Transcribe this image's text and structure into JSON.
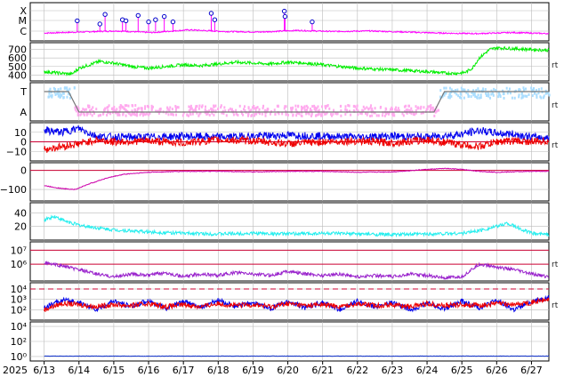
{
  "chart_data": {
    "type": "line",
    "x_axis": {
      "year_label": "2025",
      "start": "2025-06-13",
      "end": "2025-06-27",
      "tick_labels": [
        "6/13",
        "6/14",
        "6/15",
        "6/16",
        "6/17",
        "6/18",
        "6/19",
        "6/20",
        "6/21",
        "6/22",
        "6/23",
        "6/24",
        "6/25",
        "6/26",
        "6/27"
      ],
      "grid": true
    },
    "colors": {
      "magenta": "#ff00ff",
      "green": "#00ee00",
      "light_blue": "#aaddff",
      "pink": "#ffaaee",
      "gray": "#777777",
      "blue": "#0000ee",
      "red": "#ee0000",
      "crimson": "#cc0033",
      "purple_line": "#cc00aa",
      "cyan": "#22eeee",
      "violet": "#9922cc",
      "dark_blue": "#1133cc",
      "grid": "#bbbbbb"
    },
    "panels": [
      {
        "id": "xray",
        "type": "line",
        "y_tick_labels": [
          "X",
          "M",
          "C"
        ],
        "right_label": "",
        "series": [
          {
            "color": "magenta",
            "values": [
              0.15,
              0.25,
              0.35,
              0.2,
              0.45,
              0.3,
              0.25,
              0.4,
              0.3,
              0.35,
              0.25,
              0.15,
              0.1,
              0.2,
              0.1
            ]
          }
        ],
        "flare_markers": [
          {
            "x": 0.95,
            "level": 1.3
          },
          {
            "x": 1.6,
            "level": 1.0
          },
          {
            "x": 1.75,
            "level": 1.9
          },
          {
            "x": 2.25,
            "level": 1.4
          },
          {
            "x": 2.35,
            "level": 1.3
          },
          {
            "x": 2.7,
            "level": 1.8
          },
          {
            "x": 3.0,
            "level": 1.2
          },
          {
            "x": 3.2,
            "level": 1.4
          },
          {
            "x": 3.45,
            "level": 1.7
          },
          {
            "x": 3.7,
            "level": 1.2
          },
          {
            "x": 4.8,
            "level": 2.0
          },
          {
            "x": 4.9,
            "level": 1.4
          },
          {
            "x": 6.9,
            "level": 2.2
          },
          {
            "x": 6.92,
            "level": 1.7
          },
          {
            "x": 7.7,
            "level": 1.2
          }
        ]
      },
      {
        "id": "solar_wind_speed",
        "type": "line",
        "y_tick_labels": [
          "700",
          "600",
          "500",
          "400"
        ],
        "y_ticks": [
          700,
          600,
          500,
          400
        ],
        "ylim": [
          330,
          780
        ],
        "right_label": "rt",
        "series": [
          {
            "color": "green",
            "x": [
              0,
              0.5,
              0.8,
              1.0,
              1.3,
              1.6,
              2.0,
              2.5,
              3.0,
              3.5,
              4.0,
              4.5,
              5.0,
              5.5,
              6.0,
              6.5,
              7.0,
              7.5,
              8.0,
              8.5,
              9.0,
              9.5,
              10.0,
              10.5,
              11.0,
              11.3,
              11.6,
              11.9,
              12.1,
              12.3,
              12.5,
              12.8,
              13.0,
              13.5,
              14.0,
              14.5
            ],
            "values": [
              440,
              420,
              410,
              480,
              520,
              560,
              540,
              500,
              480,
              500,
              520,
              510,
              530,
              550,
              540,
              530,
              550,
              540,
              520,
              500,
              480,
              470,
              460,
              450,
              440,
              430,
              420,
              420,
              430,
              480,
              600,
              700,
              720,
              710,
              700,
              690
            ]
          }
        ]
      },
      {
        "id": "imf_sector",
        "type": "line",
        "y_tick_labels": [
          "T",
          "A"
        ],
        "right_label": "rt",
        "series": [
          {
            "color": "gray",
            "x": [
              0,
              0.7,
              1.0,
              1.1,
              11.2,
              11.5,
              14.5
            ],
            "values": [
              1,
              1,
              0,
              0,
              0,
              1,
              1
            ]
          }
        ]
      },
      {
        "id": "imf_components",
        "type": "line",
        "y_tick_labels": [
          "10",
          "0",
          "−10"
        ],
        "y_ticks": [
          10,
          0,
          -10
        ],
        "ylim": [
          -20,
          20
        ],
        "right_label": "rt",
        "series": [
          {
            "color": "blue",
            "x": [
              0,
              0.5,
              1.0,
              1.5,
              2.0,
              3.0,
              4.0,
              5.0,
              6.0,
              7.0,
              8.0,
              9.0,
              10.0,
              11.0,
              12.0,
              12.5,
              13.0,
              13.5,
              14.0,
              14.5
            ],
            "values": [
              12,
              10,
              14,
              6,
              5,
              5,
              6,
              5,
              6,
              7,
              6,
              5,
              6,
              5,
              8,
              12,
              9,
              8,
              5,
              4
            ]
          },
          {
            "color": "red",
            "x": [
              0,
              0.5,
              1.0,
              1.5,
              2.0,
              3.0,
              4.0,
              5.0,
              6.0,
              7.0,
              8.0,
              9.0,
              10.0,
              11.0,
              12.0,
              12.5,
              13.0,
              13.5,
              14.0,
              14.5
            ],
            "values": [
              -8,
              -5,
              -2,
              2,
              0,
              1,
              -1,
              2,
              1,
              -2,
              0,
              1,
              -1,
              2,
              -3,
              -5,
              0,
              1,
              0,
              1
            ]
          }
        ]
      },
      {
        "id": "dst",
        "type": "line",
        "y_tick_labels": [
          "0",
          "−100"
        ],
        "y_ticks": [
          0,
          -100
        ],
        "ylim": [
          -160,
          40
        ],
        "right_label": "",
        "series": [
          {
            "color": "purple_line",
            "x": [
              0,
              0.5,
              0.9,
              1.3,
              1.8,
              2.3,
              3.0,
              4.0,
              5.0,
              6.0,
              7.0,
              8.0,
              9.0,
              10.0,
              11.0,
              11.5,
              12.0,
              12.5,
              13.0,
              14.0,
              14.5
            ],
            "values": [
              -80,
              -95,
              -100,
              -70,
              -40,
              -20,
              -10,
              -5,
              -5,
              -8,
              -5,
              -5,
              -10,
              -8,
              5,
              10,
              5,
              -5,
              -10,
              -5,
              -5
            ]
          }
        ]
      },
      {
        "id": "density",
        "type": "line",
        "y_tick_labels": [
          "40",
          "20"
        ],
        "y_ticks": [
          40,
          20
        ],
        "ylim": [
          0,
          55
        ],
        "right_label": "",
        "series": [
          {
            "color": "cyan",
            "x": [
              0,
              0.3,
              0.6,
              1.0,
              1.5,
              2.0,
              3.0,
              4.0,
              5.0,
              6.0,
              7.0,
              8.0,
              9.0,
              10.0,
              11.0,
              12.0,
              12.5,
              13.0,
              13.3,
              13.6,
              14.0,
              14.5
            ],
            "values": [
              30,
              35,
              28,
              22,
              18,
              15,
              12,
              10,
              9,
              10,
              9,
              10,
              9,
              8,
              9,
              10,
              14,
              20,
              25,
              18,
              10,
              8
            ]
          }
        ]
      },
      {
        "id": "proton_flux",
        "type": "line",
        "y_tick_labels": [
          "10⁷",
          "10⁶"
        ],
        "y_ticks": [
          7,
          6
        ],
        "ylim": [
          4.8,
          7.6
        ],
        "log_scale": true,
        "right_label": "rt",
        "threshold_lines": [
          7,
          6
        ],
        "series": [
          {
            "color": "violet",
            "x": [
              0,
              0.5,
              1.0,
              1.5,
              2.0,
              2.5,
              3.0,
              3.5,
              4.0,
              4.5,
              5.0,
              5.5,
              6.0,
              6.5,
              7.0,
              7.5,
              8.0,
              8.5,
              9.0,
              9.5,
              10.0,
              10.5,
              11.0,
              11.5,
              12.0,
              12.5,
              13.0,
              13.5,
              14.0,
              14.5
            ],
            "values": [
              6.1,
              5.9,
              5.6,
              5.3,
              5.1,
              5.3,
              5.2,
              5.4,
              5.1,
              5.3,
              5.2,
              5.4,
              5.3,
              5.2,
              5.5,
              5.3,
              5.2,
              5.3,
              5.1,
              5.2,
              5.1,
              5.3,
              5.2,
              5.0,
              5.1,
              6.0,
              5.8,
              5.6,
              5.3,
              5.1
            ]
          }
        ]
      },
      {
        "id": "electron_flux",
        "type": "line",
        "y_tick_labels": [
          "10⁴",
          "10³",
          "10²"
        ],
        "y_ticks": [
          4,
          3,
          2
        ],
        "ylim": [
          1.0,
          4.6
        ],
        "log_scale": true,
        "right_label": "rt",
        "threshold_lines": [
          4
        ],
        "series": [
          {
            "color": "blue",
            "x": [
              0,
              0.5,
              1.0,
              1.5,
              2.0,
              2.5,
              3.0,
              3.5,
              4.0,
              4.5,
              5.0,
              5.5,
              6.0,
              6.5,
              7.0,
              7.5,
              8.0,
              8.5,
              9.0,
              9.5,
              10.0,
              10.5,
              11.0,
              11.5,
              12.0,
              12.5,
              13.0,
              13.5,
              14.0,
              14.5
            ],
            "values": [
              2.2,
              2.9,
              2.7,
              2.0,
              2.8,
              2.3,
              2.9,
              2.1,
              2.8,
              2.2,
              2.9,
              2.3,
              2.7,
              2.1,
              2.8,
              2.2,
              2.7,
              2.0,
              2.8,
              2.3,
              2.7,
              2.0,
              2.6,
              2.1,
              2.8,
              2.2,
              2.9,
              2.0,
              2.8,
              3.2
            ]
          },
          {
            "color": "red",
            "x": [
              0,
              0.5,
              1.0,
              1.5,
              2.0,
              2.5,
              3.0,
              3.5,
              4.0,
              4.5,
              5.0,
              5.5,
              6.0,
              6.5,
              7.0,
              7.5,
              8.0,
              8.5,
              9.0,
              9.5,
              10.0,
              10.5,
              11.0,
              11.5,
              12.0,
              12.5,
              13.0,
              13.5,
              14.0,
              14.5
            ],
            "values": [
              2.0,
              2.6,
              2.5,
              2.3,
              2.5,
              2.4,
              2.6,
              2.3,
              2.5,
              2.3,
              2.6,
              2.4,
              2.5,
              2.3,
              2.6,
              2.4,
              2.5,
              2.3,
              2.6,
              2.4,
              2.5,
              2.3,
              2.6,
              2.4,
              2.5,
              2.4,
              2.6,
              2.5,
              2.7,
              3.0
            ]
          }
        ]
      },
      {
        "id": "high_energy_electrons",
        "type": "line",
        "y_tick_labels": [
          "10⁴",
          "10²",
          "10⁰"
        ],
        "y_ticks": [
          4,
          2,
          0
        ],
        "ylim": [
          -0.6,
          4.6
        ],
        "log_scale": true,
        "right_label": "",
        "series": [
          {
            "color": "dark_blue",
            "x": [
              0,
              14.5
            ],
            "values": [
              0.05,
              0.05
            ]
          }
        ]
      }
    ]
  }
}
